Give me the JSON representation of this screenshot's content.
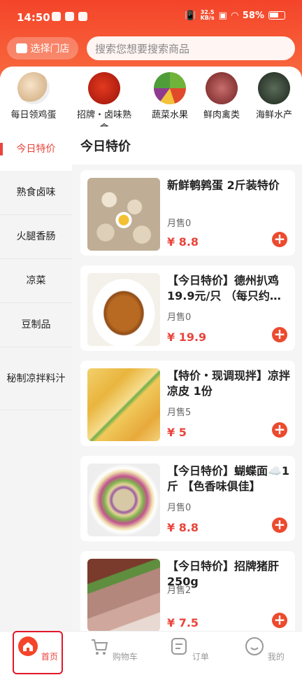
{
  "status_bar": {
    "time": "14:50",
    "net_speed_top": "32.5",
    "net_speed_bottom": "KB/s",
    "battery": "58%"
  },
  "header": {
    "store_label": "选择门店",
    "search_placeholder": "搜索您想要搜索商品"
  },
  "categories": [
    {
      "label": "每日领鸡蛋",
      "active": false
    },
    {
      "label": "招牌・卤味熟食",
      "active": true
    },
    {
      "label": "蔬菜水果",
      "active": false
    },
    {
      "label": "鲜肉禽类",
      "active": false
    },
    {
      "label": "海鲜水产",
      "active": false
    }
  ],
  "sidebar": {
    "items": [
      "今日特价",
      "熟食卤味",
      "火腿香肠",
      "凉菜",
      "豆制品",
      "秘制凉拌料汁"
    ]
  },
  "section_title": "今日特价",
  "products": [
    {
      "title": "新鲜鹌鹑蛋 2斤装特价",
      "sold": "月售0",
      "price": "¥ 8.8"
    },
    {
      "title": "【今日特价】德州扒鸡19.9元/只 （每只约…",
      "sold": "月售0",
      "price": "¥ 19.9"
    },
    {
      "title": "【特价・现调现拌】凉拌凉皮 1份",
      "sold": "月售5",
      "price": "¥ 5"
    },
    {
      "title": "【今日特价】蝴蝶面☁️1斤 【色香味俱佳】",
      "sold": "月售0",
      "price": "¥ 8.8"
    },
    {
      "title": "【今日特价】招牌猪肝250g",
      "sold": "月售2",
      "price": "¥ 7.5"
    }
  ],
  "add_symbol": "+",
  "tabbar": [
    {
      "label": "首页",
      "icon": "home-icon",
      "active": true
    },
    {
      "label": "购物车",
      "icon": "cart-icon",
      "active": false
    },
    {
      "label": "订单",
      "icon": "order-icon",
      "active": false
    },
    {
      "label": "我的",
      "icon": "profile-icon",
      "active": false
    }
  ],
  "colors": {
    "brand": "#f4442a",
    "accent": "#e8453c",
    "tab_highlight": "#e0182a"
  }
}
